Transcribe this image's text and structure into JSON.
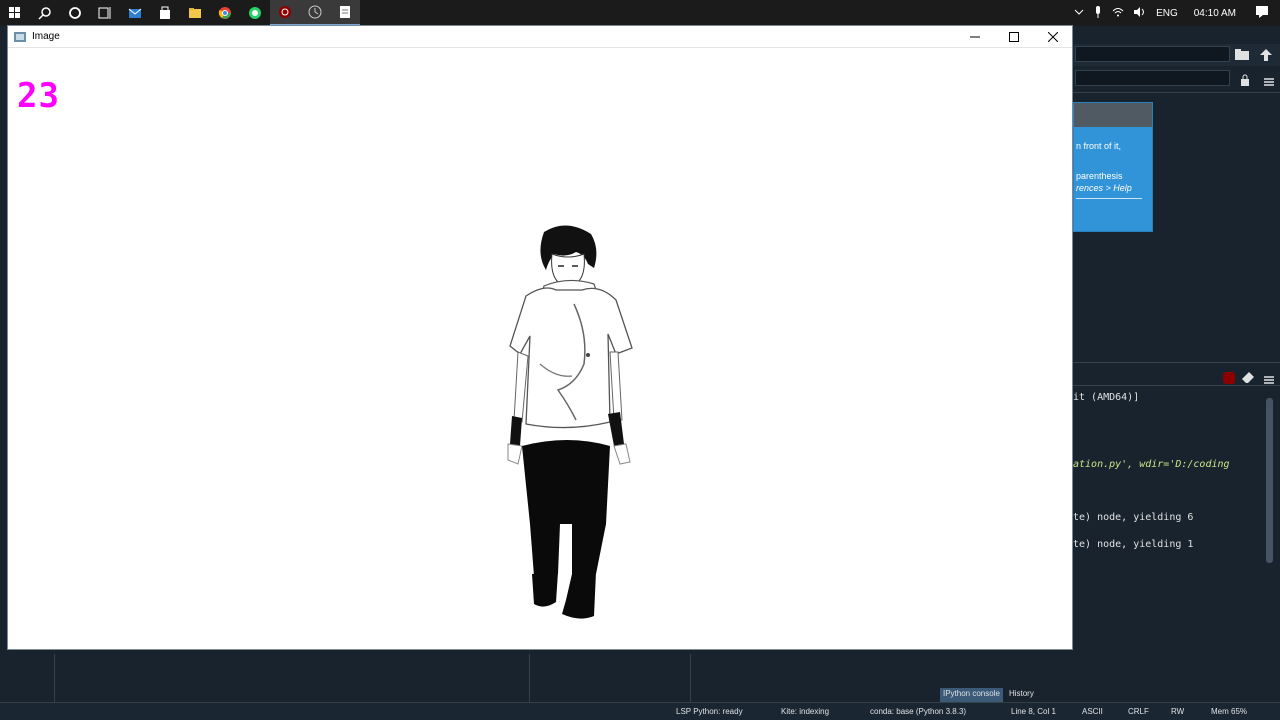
{
  "tray": {
    "language": "ENG",
    "time": "04:10 AM"
  },
  "window": {
    "title": "Image"
  },
  "canvas": {
    "frame_counter": "23"
  },
  "help_panel": {
    "lines": [
      "n front of it,",
      "parenthesis",
      "rences > Help"
    ]
  },
  "console": {
    "lines": [
      {
        "text": "it (AMD64)]",
        "style": "normal"
      },
      {
        "text": "ation.py', wdir='D:/coding",
        "style": "green"
      },
      {
        "text": "te) node, yielding 6",
        "style": "normal"
      },
      {
        "text": "te) node, yielding 1",
        "style": "normal"
      }
    ]
  },
  "bottom_tabs": [
    "IPython console",
    "History"
  ],
  "status": {
    "lsp": "LSP Python: ready",
    "kite": "Kite: indexing",
    "conda": "conda: base (Python 3.8.3)",
    "position": "Line 8, Col 1",
    "encoding": "ASCII",
    "eol": "CRLF",
    "rw": "RW",
    "mem": "Mem 65%"
  }
}
